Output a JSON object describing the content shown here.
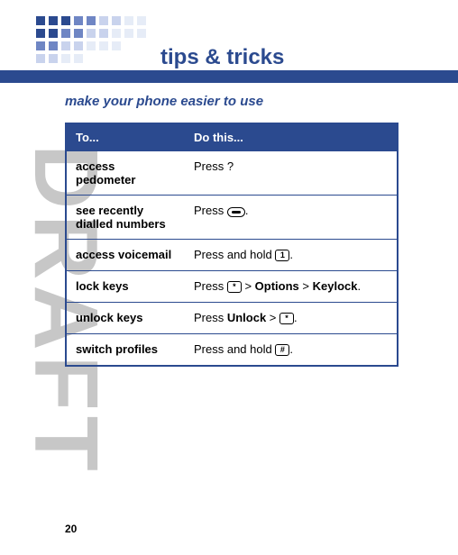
{
  "header": {
    "title": "tips & tricks",
    "subtitle": "make your phone easier to use"
  },
  "watermark": "DRAFT",
  "page_number": "20",
  "table": {
    "head": {
      "col1": "To...",
      "col2": "Do this..."
    },
    "rows": [
      {
        "task": "access pedometer",
        "action_prefix": "Press ?",
        "action_suffix": ""
      },
      {
        "task": "see recently dialled numbers",
        "action_prefix": "Press ",
        "key_icon": "send",
        "action_suffix": "."
      },
      {
        "task": "access voicemail",
        "action_prefix": "Press and hold ",
        "key_icon": "1",
        "action_suffix": "."
      },
      {
        "task": "lock keys",
        "action_prefix": "Press ",
        "key_icon": "star",
        "mid1": " > ",
        "menu1": "Options",
        "mid2": " > ",
        "menu2": "Keylock",
        "action_suffix": "."
      },
      {
        "task": "unlock keys",
        "action_prefix": "Press ",
        "menu1": "Unlock",
        "mid1": " > ",
        "key_icon": "star",
        "action_suffix": "."
      },
      {
        "task": "switch profiles",
        "action_prefix": "Press and hold ",
        "key_icon": "hash",
        "action_suffix": "."
      }
    ]
  },
  "icons": {
    "send": "",
    "1": "1",
    "star": "*",
    "hash": "#"
  }
}
